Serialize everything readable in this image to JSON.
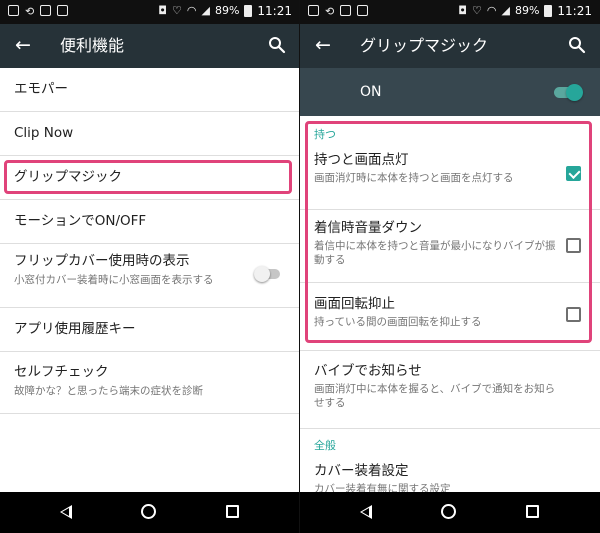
{
  "status_bar": {
    "battery": "89%",
    "time": "11:21"
  },
  "left": {
    "title": "便利機能",
    "items": [
      {
        "title": "エモパー"
      },
      {
        "title": "Clip Now"
      },
      {
        "title": "グリップマジック"
      },
      {
        "title": "モーションでON/OFF"
      },
      {
        "title": "フリップカバー使用時の表示",
        "subtitle": "小窓付カバー装着時に小窓画面を表示する",
        "toggle": "off"
      },
      {
        "title": "アプリ使用履歴キー"
      },
      {
        "title": "セルフチェック",
        "subtitle": "故障かな？と思ったら端末の症状を診断"
      }
    ]
  },
  "right": {
    "title": "グリップマジック",
    "master_switch_label": "ON",
    "sections": [
      {
        "header": "持つ",
        "items": [
          {
            "title": "持つと画面点灯",
            "subtitle": "画面消灯時に本体を持つと画面を点灯する",
            "checked": true
          },
          {
            "title": "着信時音量ダウン",
            "subtitle": "着信中に本体を持つと音量が最小になりバイブが振動する",
            "checked": false
          },
          {
            "title": "画面回転抑止",
            "subtitle": "持っている間の画面回転を抑止する",
            "checked": false
          },
          {
            "title": "バイブでお知らせ",
            "subtitle": "画面消灯中に本体を握ると、バイブで通知をお知らせする"
          }
        ]
      },
      {
        "header": "全般",
        "items": [
          {
            "title": "カバー装着設定",
            "subtitle": "カバー装着有無に関する設定"
          }
        ]
      }
    ]
  },
  "colors": {
    "toolbar": "#263238",
    "subheader": "#37474f",
    "accent": "#26a69a",
    "highlight": "#e0437a"
  },
  "icons": [
    "back-arrow-icon",
    "search-icon",
    "nav-back-icon",
    "nav-home-icon",
    "nav-recent-icon"
  ]
}
